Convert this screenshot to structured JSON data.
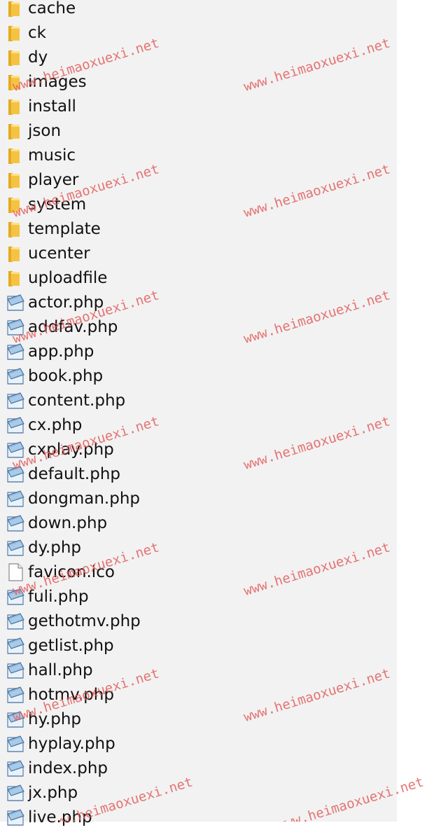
{
  "entries": [
    {
      "name": "cache",
      "type": "folder"
    },
    {
      "name": "ck",
      "type": "folder"
    },
    {
      "name": "dy",
      "type": "folder"
    },
    {
      "name": "images",
      "type": "folder"
    },
    {
      "name": "install",
      "type": "folder"
    },
    {
      "name": "json",
      "type": "folder"
    },
    {
      "name": "music",
      "type": "folder"
    },
    {
      "name": "player",
      "type": "folder"
    },
    {
      "name": "system",
      "type": "folder"
    },
    {
      "name": "template",
      "type": "folder"
    },
    {
      "name": "ucenter",
      "type": "folder"
    },
    {
      "name": "uploadfile",
      "type": "folder"
    },
    {
      "name": "actor.php",
      "type": "php"
    },
    {
      "name": "addfav.php",
      "type": "php"
    },
    {
      "name": "app.php",
      "type": "php"
    },
    {
      "name": "book.php",
      "type": "php"
    },
    {
      "name": "content.php",
      "type": "php"
    },
    {
      "name": "cx.php",
      "type": "php"
    },
    {
      "name": "cxplay.php",
      "type": "php"
    },
    {
      "name": "default.php",
      "type": "php"
    },
    {
      "name": "dongman.php",
      "type": "php"
    },
    {
      "name": "down.php",
      "type": "php"
    },
    {
      "name": "dy.php",
      "type": "php"
    },
    {
      "name": "favicon.ico",
      "type": "file"
    },
    {
      "name": "fuli.php",
      "type": "php"
    },
    {
      "name": "gethotmv.php",
      "type": "php"
    },
    {
      "name": "getlist.php",
      "type": "php"
    },
    {
      "name": "hall.php",
      "type": "php"
    },
    {
      "name": "hotmv.php",
      "type": "php"
    },
    {
      "name": "hy.php",
      "type": "php"
    },
    {
      "name": "hyplay.php",
      "type": "php"
    },
    {
      "name": "index.php",
      "type": "php"
    },
    {
      "name": "jx.php",
      "type": "php"
    },
    {
      "name": "live.php",
      "type": "php"
    }
  ],
  "watermark": "www.heimaoxuexi.net",
  "colors": {
    "folder": "#f5c342",
    "watermark": "#e35d5d",
    "pane": "#f2f2f2"
  }
}
